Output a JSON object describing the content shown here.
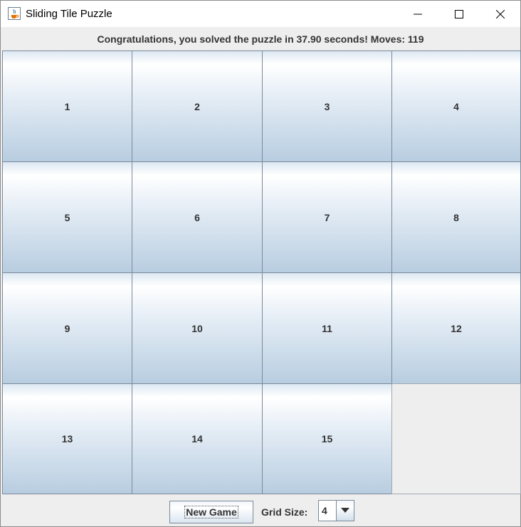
{
  "window": {
    "title": "Sliding Tile Puzzle",
    "icon": "java-cup-icon"
  },
  "status": {
    "message": "Congratulations, you solved the puzzle in 37.90 seconds!  Moves: 119"
  },
  "board": {
    "size": 4,
    "tiles": [
      "1",
      "2",
      "3",
      "4",
      "5",
      "6",
      "7",
      "8",
      "9",
      "10",
      "11",
      "12",
      "13",
      "14",
      "15",
      ""
    ]
  },
  "controls": {
    "new_game_label": "New Game",
    "grid_size_label": "Grid Size:",
    "grid_size_value": "4"
  },
  "colors": {
    "accent": "#c7d8e8",
    "text": "#333333",
    "background": "#eeeeee"
  }
}
